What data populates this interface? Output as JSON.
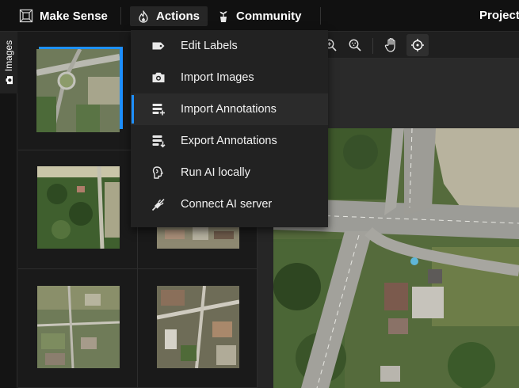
{
  "topbar": {
    "brand": "Make Sense",
    "actions_label": "Actions",
    "community_label": "Community",
    "project_label": "Project"
  },
  "side_tab": {
    "label": "Images",
    "icon": "camera-icon"
  },
  "image_list": {
    "selected_index": 0,
    "count_visible": 6
  },
  "toolbar": {
    "tools": [
      "zoom-in-icon",
      "zoom-fit-icon",
      "pan-hand-icon",
      "crosshair-icon"
    ],
    "active_tool": "crosshair-icon"
  },
  "actions_menu": {
    "items": [
      {
        "label": "Edit Labels",
        "icon": "tag-icon"
      },
      {
        "label": "Import Images",
        "icon": "camera-icon"
      },
      {
        "label": "Import Annotations",
        "icon": "import-annotations-icon",
        "hovered": true
      },
      {
        "label": "Export Annotations",
        "icon": "export-annotations-icon"
      },
      {
        "label": "Run AI locally",
        "icon": "brain-icon"
      },
      {
        "label": "Connect AI server",
        "icon": "plug-icon"
      }
    ]
  },
  "colors": {
    "accent": "#1e90ff",
    "topbar_bg": "#111111",
    "menu_bg": "#222222",
    "panel_bg": "#1a1a1a"
  }
}
